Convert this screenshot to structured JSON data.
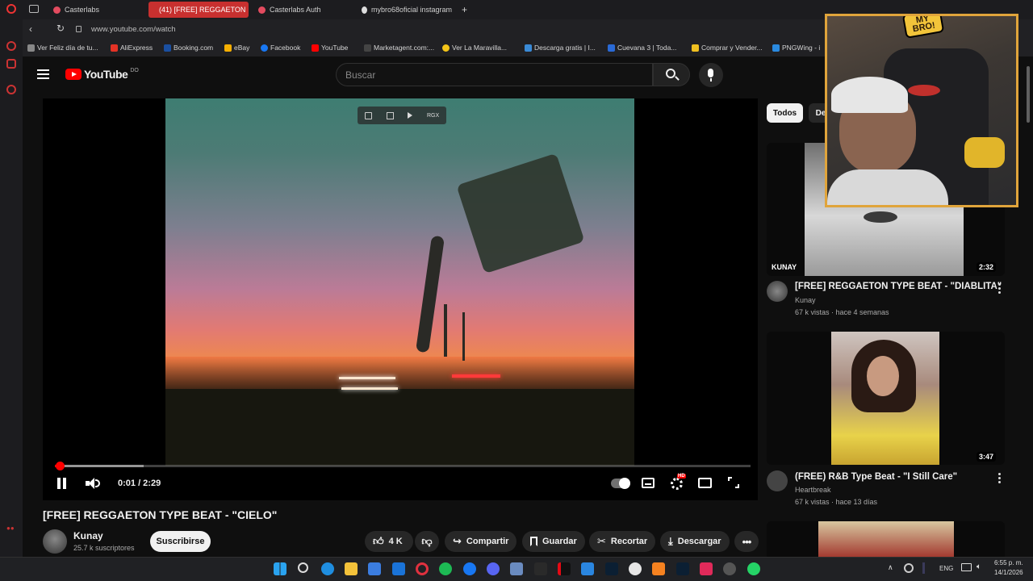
{
  "browser": {
    "tabs": [
      {
        "label": "Casterlabs",
        "active": false
      },
      {
        "label": "(41) [FREE] REGGAETON",
        "active": true
      },
      {
        "label": "Casterlabs Auth",
        "active": false
      },
      {
        "label": "mybro68oficial instagram",
        "active": false
      }
    ],
    "new_tab_label": "+",
    "url": "www.youtube.com/watch",
    "bookmarks": [
      "Ver Feliz día de tu...",
      "AliExpress",
      "Booking.com",
      "eBay",
      "Facebook",
      "YouTube",
      "Marketagent.com:...",
      "Ver La Maravilla...",
      "Descarga gratis | I...",
      "Cuevana 3 | Toda...",
      "Comprar y Vender...",
      "PNGWing - i"
    ]
  },
  "youtube": {
    "logo_text": "YouTube",
    "country_code": "DO",
    "search": {
      "placeholder": "Buscar"
    },
    "player": {
      "overlay_text": "RGX",
      "time": "0:01 / 2:29",
      "progress_fraction": 0.0075,
      "hd_badge": "HD"
    },
    "video": {
      "title": "[FREE] REGGAETON TYPE BEAT - \"CIELO\"",
      "channel": "Kunay",
      "subscribers": "25.7 k suscriptores",
      "subscribe_label": "Suscribirse",
      "likes": "4 K",
      "share_label": "Compartir",
      "save_label": "Guardar",
      "clip_label": "Recortar",
      "download_label": "Descargar"
    },
    "chips": [
      "Todos",
      "De"
    ],
    "recommendations": [
      {
        "title": "[FREE] REGGAETON TYPE BEAT - \"DIABLITA\"",
        "channel": "Kunay",
        "meta": "67 k vistas · hace 4 semanas",
        "duration": "2:32",
        "thumb_text": "KUNAY"
      },
      {
        "title": "(FREE) R&B Type Beat - \"I Still Care\"",
        "channel": "Heartbreak",
        "meta": "67 k vistas · hace 13 días",
        "duration": "3:47"
      }
    ]
  },
  "webcam": {
    "sticker_text": "MY BRO!"
  },
  "taskbar": {
    "language": "ENG",
    "time": "6:55 p. m.",
    "date": "14/1/2026"
  },
  "colors": {
    "accent_red": "#ff0000",
    "background": "#0f0f0f",
    "webcam_border": "#e0a43b"
  }
}
